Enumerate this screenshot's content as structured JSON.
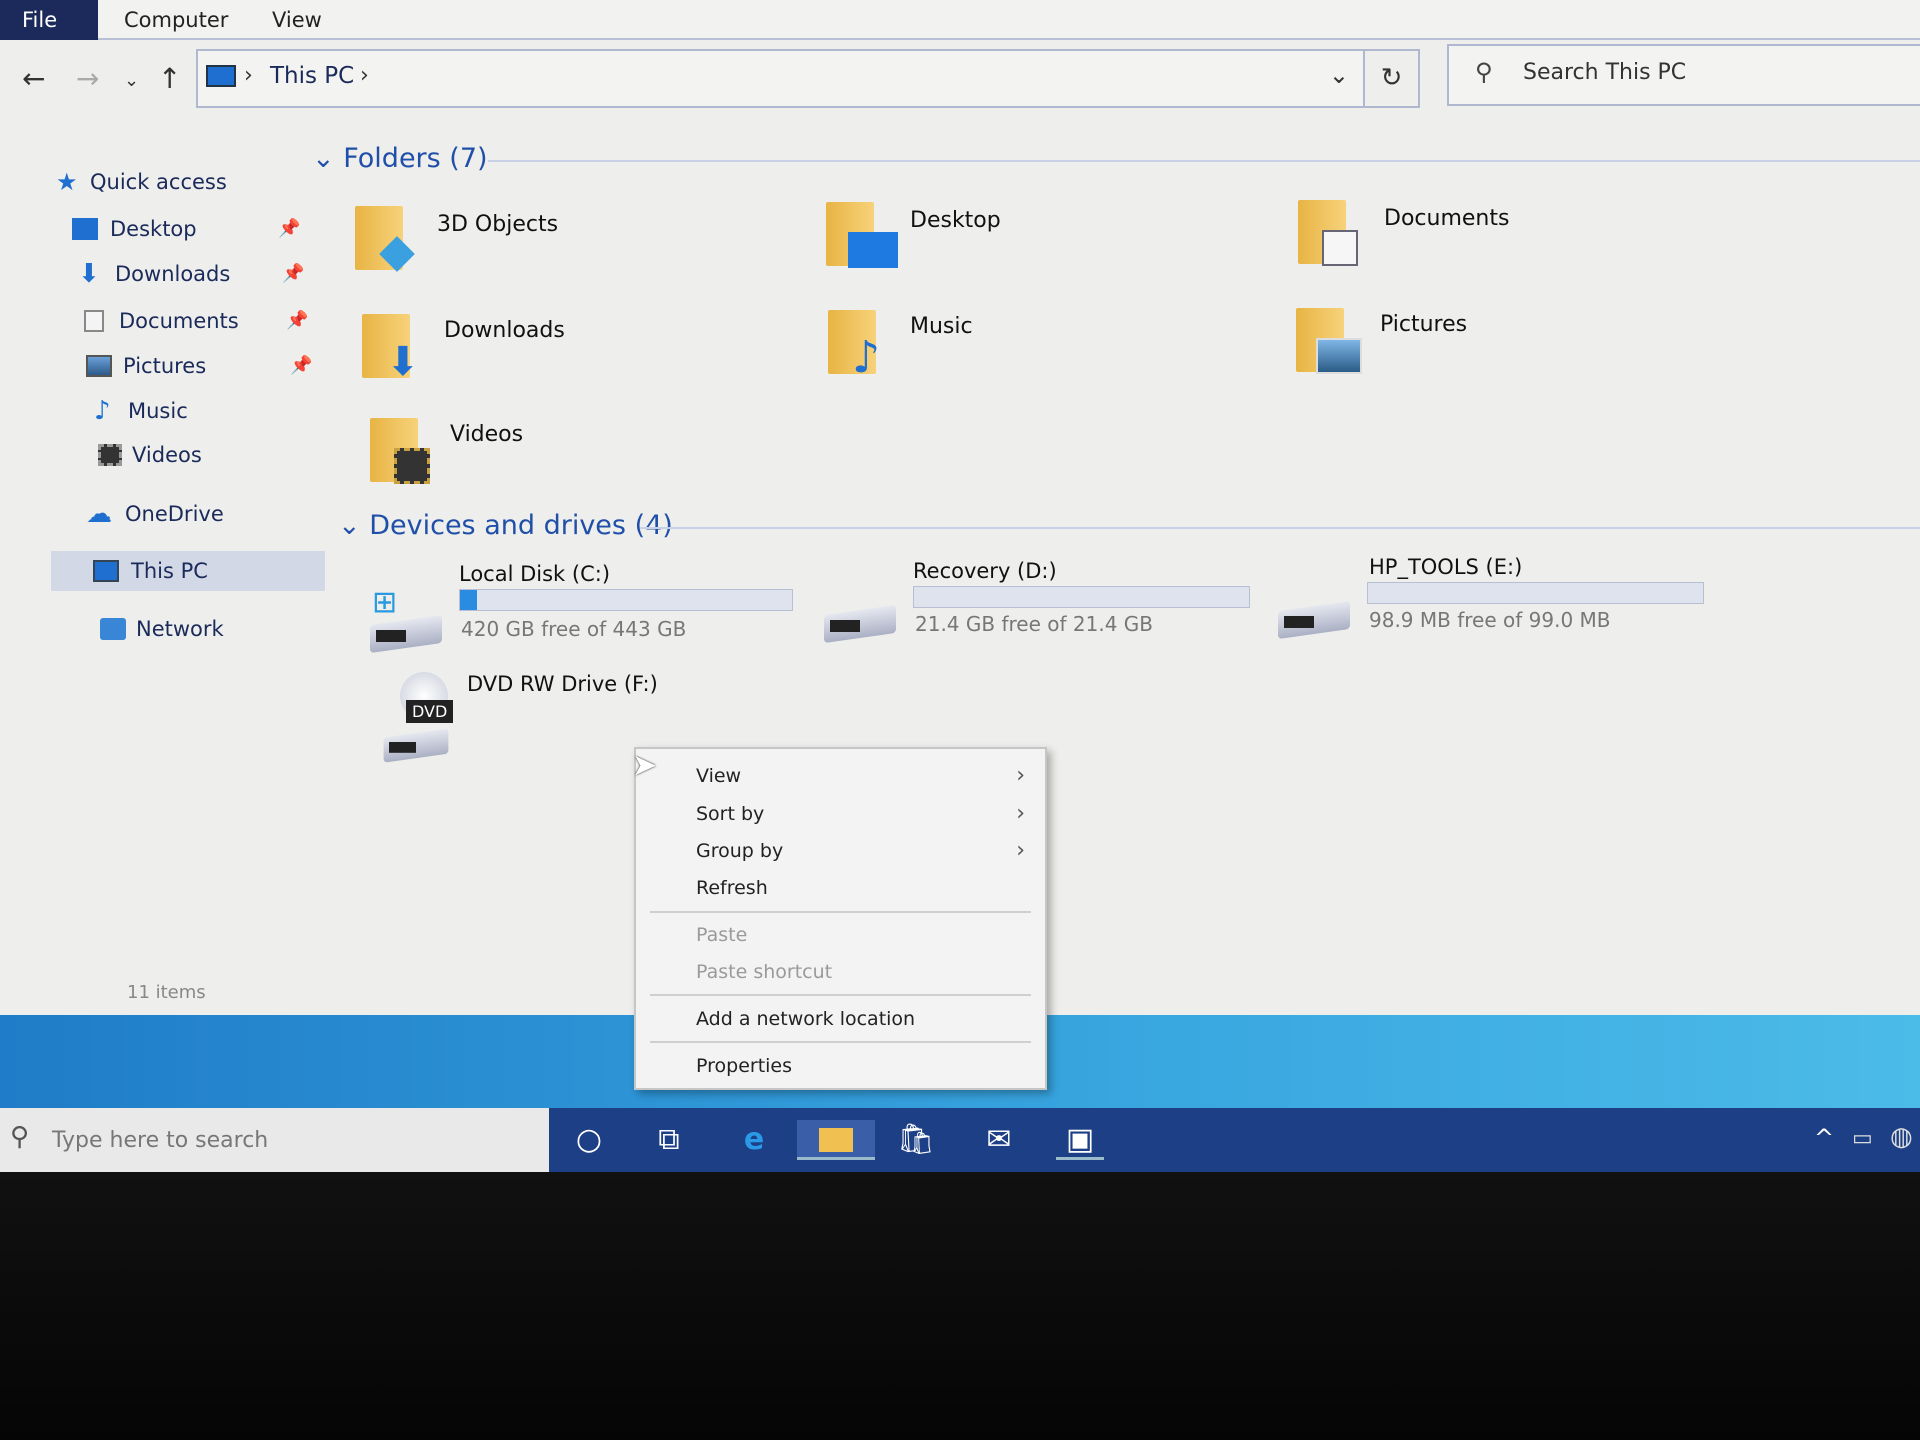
{
  "menu": {
    "file": "File",
    "computer": "Computer",
    "view": "View"
  },
  "address": {
    "crumb": "This PC",
    "search_placeholder": "Search This PC"
  },
  "sidebar": {
    "quick_access": "Quick access",
    "items": [
      {
        "label": "Desktop",
        "pinned": true
      },
      {
        "label": "Downloads",
        "pinned": true
      },
      {
        "label": "Documents",
        "pinned": true
      },
      {
        "label": "Pictures",
        "pinned": true
      },
      {
        "label": "Music",
        "pinned": false
      },
      {
        "label": "Videos",
        "pinned": false
      }
    ],
    "onedrive": "OneDrive",
    "this_pc": "This PC",
    "network": "Network"
  },
  "folders": {
    "header": "Folders (7)",
    "items": [
      "3D Objects",
      "Desktop",
      "Documents",
      "Downloads",
      "Music",
      "Pictures",
      "Videos"
    ]
  },
  "drives": {
    "header": "Devices and drives (4)",
    "items": [
      {
        "name": "Local Disk (C:)",
        "free": "420 GB free of 443 GB",
        "used_fraction": 0.05
      },
      {
        "name": "Recovery (D:)",
        "free": "21.4 GB free of 21.4 GB",
        "used_fraction": 0.0
      },
      {
        "name": "HP_TOOLS (E:)",
        "free": "98.9 MB free of 99.0 MB",
        "used_fraction": 0.0
      },
      {
        "name": "DVD RW Drive (F:)",
        "badge": "DVD"
      }
    ]
  },
  "status": {
    "count": "11 items"
  },
  "context_menu": {
    "items": [
      "View",
      "Sort by",
      "Group by",
      "Refresh",
      "Paste",
      "Paste shortcut",
      "Add a network location",
      "Properties"
    ]
  },
  "taskbar": {
    "search_placeholder": "Type here to search"
  }
}
